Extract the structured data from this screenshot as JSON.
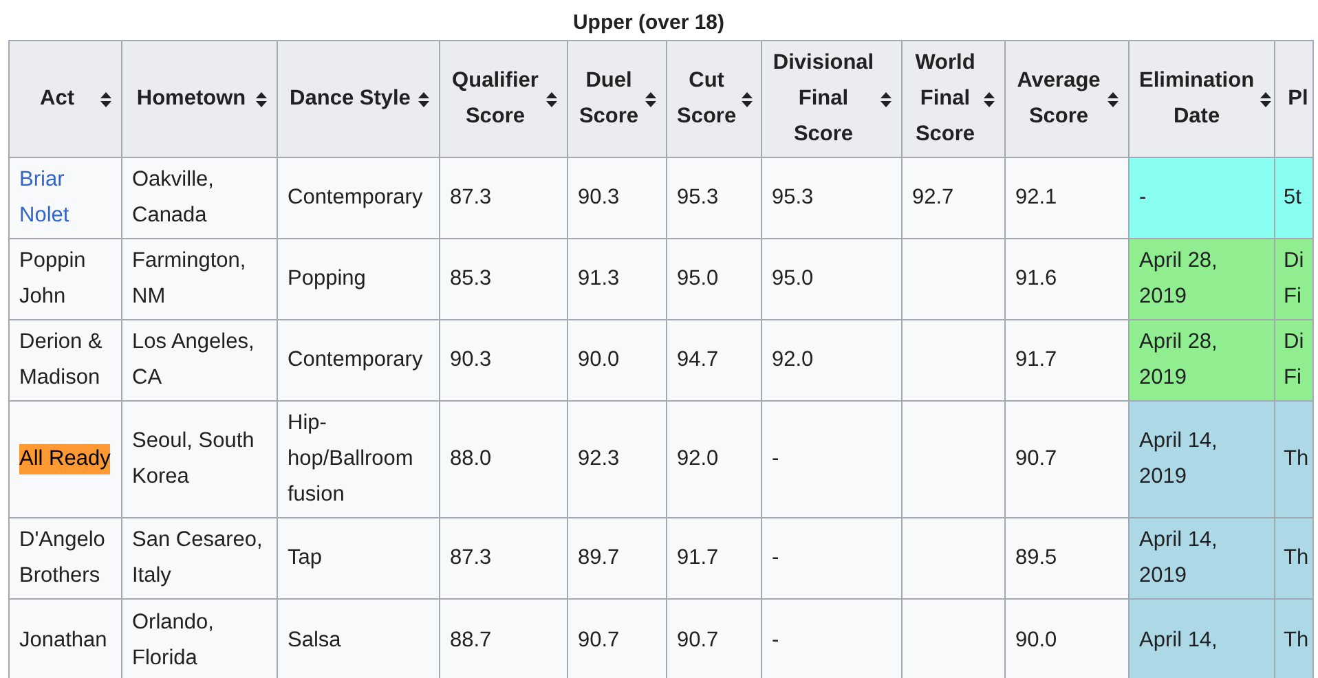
{
  "table": {
    "caption": "Upper (over 18)",
    "columns": [
      {
        "label": "Act",
        "sortable": true
      },
      {
        "label": "Hometown",
        "sortable": true
      },
      {
        "label": "Dance Style",
        "sortable": true
      },
      {
        "label": "Qualifier Score",
        "sortable": true
      },
      {
        "label": "Duel Score",
        "sortable": true
      },
      {
        "label": "Cut Score",
        "sortable": true
      },
      {
        "label": "Divisional Final Score",
        "sortable": true
      },
      {
        "label": "World Final Score",
        "sortable": true
      },
      {
        "label": "Average Score",
        "sortable": true
      },
      {
        "label": "Elimination Date",
        "sortable": true
      },
      {
        "label": "Pl",
        "sortable": false
      }
    ],
    "rows": [
      {
        "kind": "link",
        "cells": [
          "Briar Nolet",
          "Oakville, Canada",
          "Contemporary",
          "87.3",
          "90.3",
          "95.3",
          "95.3",
          "92.7",
          "92.1",
          "-",
          "5t"
        ],
        "color": "#88fff0"
      },
      {
        "kind": "plain",
        "cells": [
          "Poppin John",
          "Farmington, NM",
          "Popping",
          "85.3",
          "91.3",
          "95.0",
          "95.0",
          "",
          "91.6",
          "April 28, 2019",
          "Di Fi"
        ],
        "color": "#90ee90"
      },
      {
        "kind": "plain",
        "cells": [
          "Derion & Madison",
          "Los Angeles, CA",
          "Contemporary",
          "90.3",
          "90.0",
          "94.7",
          "92.0",
          "",
          "91.7",
          "April 28, 2019",
          "Di Fi"
        ],
        "color": "#90ee90"
      },
      {
        "kind": "highlight",
        "cells": [
          "All Ready",
          "Seoul, South Korea",
          "Hip-hop/Ballroom fusion",
          "88.0",
          "92.3",
          "92.0",
          "-",
          "",
          "90.7",
          "April 14, 2019",
          "Th"
        ],
        "color": "#add8e6"
      },
      {
        "kind": "plain",
        "cells": [
          "D'Angelo Brothers",
          "San Cesareo, Italy",
          "Tap",
          "87.3",
          "89.7",
          "91.7",
          "-",
          "",
          "89.5",
          "April 14, 2019",
          "Th"
        ],
        "color": "#add8e6"
      },
      {
        "kind": "plain",
        "cells": [
          "Jonathan",
          "Orlando, Florida",
          "Salsa",
          "88.7",
          "90.7",
          "90.7",
          "-",
          "",
          "90.0",
          "April 14,",
          "Th"
        ],
        "color": "#add8e6"
      }
    ]
  }
}
